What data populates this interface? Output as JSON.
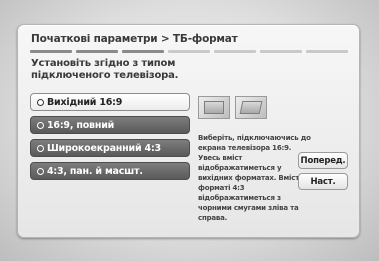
{
  "dialog": {
    "title": "Початкові параметри > ТБ-формат",
    "instruction": "Установіть згідно з типом підключеного телевізора.",
    "options": [
      {
        "label": "Вихідний 16:9",
        "selected": true
      },
      {
        "label": "16:9, повний",
        "selected": false
      },
      {
        "label": "Широкоекранний 4:3",
        "selected": false
      },
      {
        "label": "4:3, пан. й масшт.",
        "selected": false
      }
    ],
    "description": "Виберіть, підключаючись до екрана телевізора 16:9. Увесь вміст відображатиметься у вихідних форматах. Вміст у форматі 4:3 відображатиметься з чорними смугами зліва та справа.",
    "buttons": {
      "prev": "Поперед.",
      "next": "Наст."
    }
  },
  "progress": {
    "current_step": 3,
    "total_steps": 7
  }
}
